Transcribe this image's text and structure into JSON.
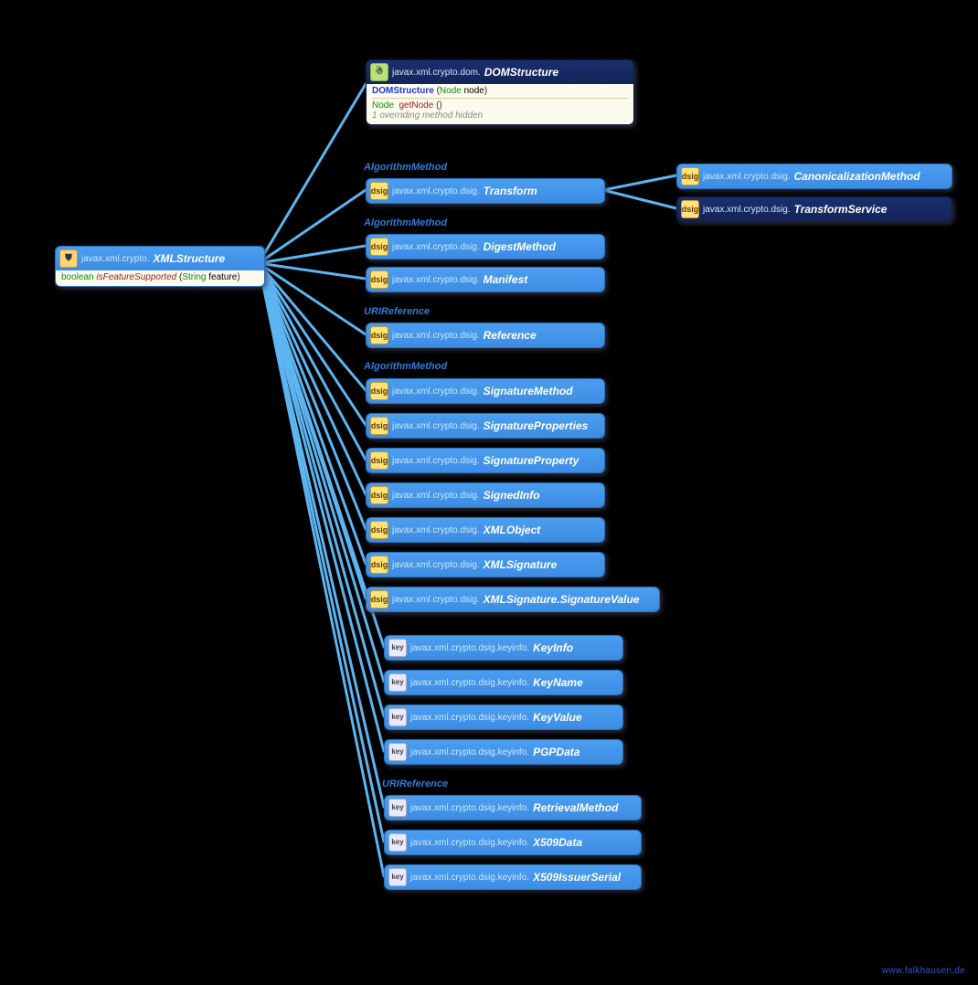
{
  "root": {
    "pkg": "javax.xml.crypto.",
    "cls": "XMLStructure",
    "method_ret": "boolean",
    "method_name": "isFeatureSupported",
    "method_p_type": "String",
    "method_p_name": "feature"
  },
  "dom": {
    "pkg": "javax.xml.crypto.dom.",
    "cls": "DOMStructure",
    "ctor": "DOMStructure",
    "ctor_p_type": "Node",
    "ctor_p_name": "node",
    "m_ret": "Node",
    "m_name": "getNode",
    "m_sig": "()",
    "hidden": "1 overriding method hidden"
  },
  "labels": {
    "algm1": "AlgorithmMethod",
    "algm2": "AlgorithmMethod",
    "uri1": "URIReference",
    "algm3": "AlgorithmMethod",
    "uri2": "URIReference"
  },
  "dsig_pkg": "javax.xml.crypto.dsig.",
  "key_pkg": "javax.xml.crypto.dsig.keyinfo.",
  "children": {
    "transform": "Transform",
    "digestMethod": "DigestMethod",
    "manifest": "Manifest",
    "reference": "Reference",
    "signatureMethod": "SignatureMethod",
    "signatureProperties": "SignatureProperties",
    "signatureProperty": "SignatureProperty",
    "signedInfo": "SignedInfo",
    "xmlObject": "XMLObject",
    "xmlSignature": "XMLSignature",
    "xmlSignatureValue": "XMLSignature.SignatureValue",
    "keyInfo": "KeyInfo",
    "keyName": "KeyName",
    "keyValue": "KeyValue",
    "pgpData": "PGPData",
    "retrievalMethod": "RetrievalMethod",
    "x509Data": "X509Data",
    "x509IssuerSerial": "X509IssuerSerial"
  },
  "right": {
    "canon": "CanonicalizationMethod",
    "transformService": "TransformService"
  },
  "watermark": "www.falkhausen.de"
}
